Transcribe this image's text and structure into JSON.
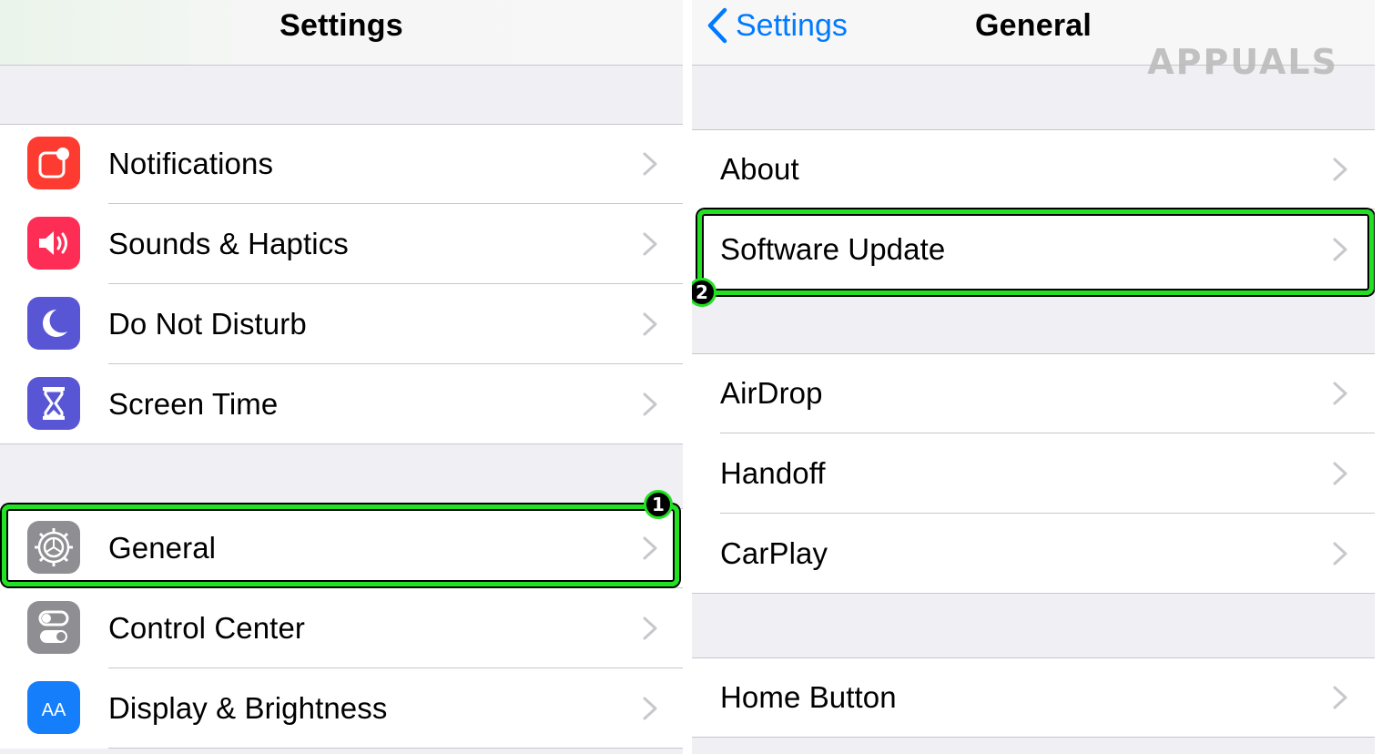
{
  "left": {
    "title": "Settings",
    "group1": [
      {
        "label": "Notifications",
        "icon": "notifications-icon",
        "color": "#fe3b30"
      },
      {
        "label": "Sounds & Haptics",
        "icon": "speaker-icon",
        "color": "#fe2d55"
      },
      {
        "label": "Do Not Disturb",
        "icon": "moon-icon",
        "color": "#5956d6"
      },
      {
        "label": "Screen Time",
        "icon": "hourglass-icon",
        "color": "#5956d6"
      }
    ],
    "group2": [
      {
        "label": "General",
        "icon": "gear-icon",
        "color": "#8e8e93"
      },
      {
        "label": "Control Center",
        "icon": "switches-icon",
        "color": "#8e8e93"
      },
      {
        "label": "Display & Brightness",
        "icon": "text-size-icon",
        "color": "#147efb",
        "icon_text": "AA"
      }
    ]
  },
  "right": {
    "back_label": "Settings",
    "title": "General",
    "group1": [
      {
        "label": "About"
      },
      {
        "label": "Software Update"
      }
    ],
    "group2": [
      {
        "label": "AirDrop"
      },
      {
        "label": "Handoff"
      },
      {
        "label": "CarPlay"
      }
    ],
    "group3": [
      {
        "label": "Home Button"
      }
    ]
  },
  "annotations": {
    "step1": "1",
    "step2": "2",
    "highlight_color": "#22e022"
  },
  "watermark": "APPUALS",
  "colors": {
    "ios_blue": "#007aff",
    "chevron": "#c7c7cc",
    "group_bg": "#efeff4"
  }
}
